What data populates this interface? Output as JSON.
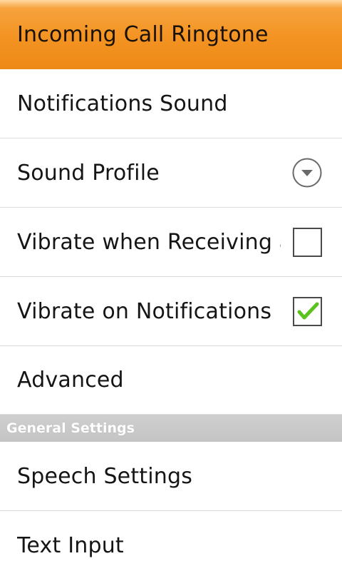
{
  "colors": {
    "selected_row": "#f39322",
    "divider": "#dcdcdc",
    "section_header_bg": "#c8c8c8",
    "checkmark": "#5cc21e"
  },
  "settings_list": {
    "rows": [
      {
        "label": "Incoming Call Ringtone",
        "selected": true
      },
      {
        "label": "Notifications Sound"
      },
      {
        "label": "Sound Profile",
        "widget_icon": "dropdown-circle-icon"
      },
      {
        "label": "Vibrate when Receiving a",
        "checked": false
      },
      {
        "label": "Vibrate on Notifications",
        "checked": true
      },
      {
        "label": "Advanced"
      }
    ]
  },
  "general_section": {
    "header": "General Settings",
    "rows": [
      {
        "label": "Speech Settings"
      },
      {
        "label": "Text Input"
      }
    ]
  }
}
